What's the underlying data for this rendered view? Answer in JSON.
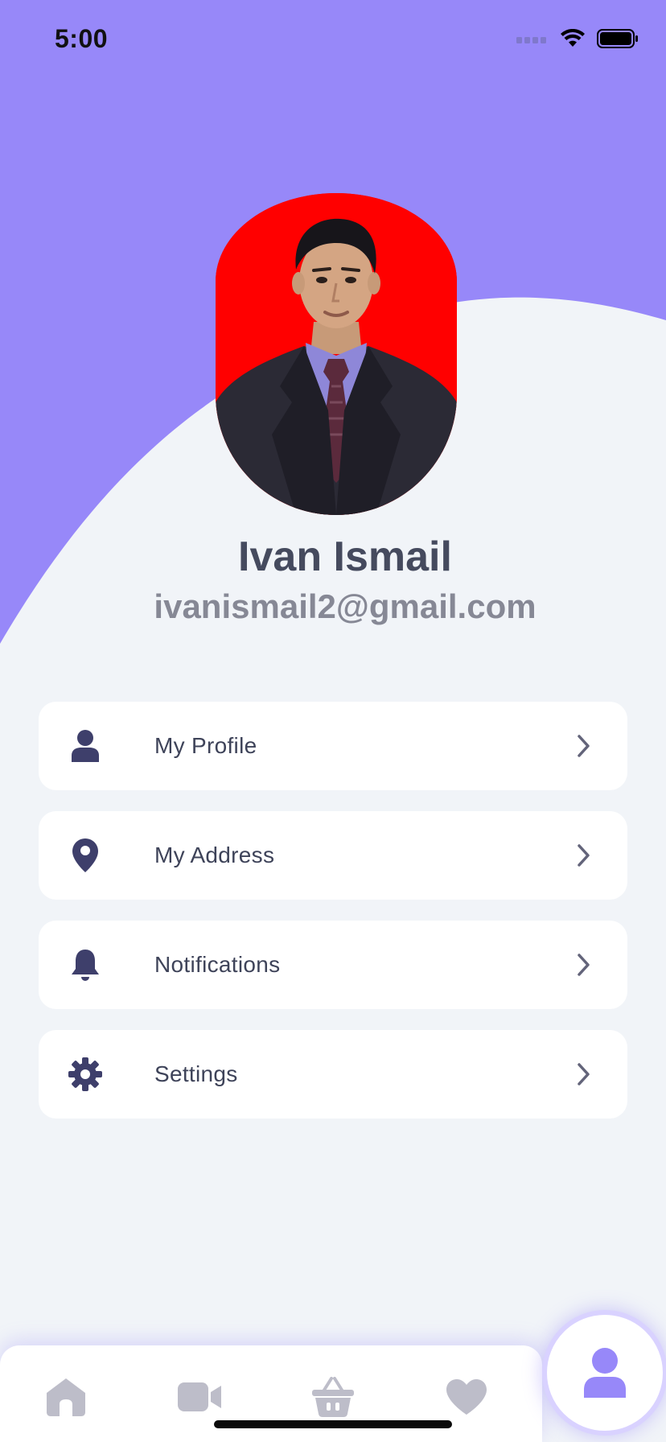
{
  "status_bar": {
    "time": "5:00"
  },
  "profile": {
    "name": "Ivan Ismail",
    "email": "ivanismail2@gmail.com",
    "avatar_icon": "profile-photo"
  },
  "menu": [
    {
      "label": "My Profile",
      "icon": "user-icon"
    },
    {
      "label": "My Address",
      "icon": "location-pin-icon"
    },
    {
      "label": "Notifications",
      "icon": "bell-icon"
    },
    {
      "label": "Settings",
      "icon": "gear-icon"
    }
  ],
  "bottom_nav": {
    "items": [
      "home-icon",
      "video-icon",
      "basket-icon",
      "heart-icon",
      "profile-icon"
    ],
    "active": "profile-icon"
  },
  "colors": {
    "accent": "#9788F9",
    "background": "#F1F4F8",
    "text_primary": "#454A5E",
    "text_secondary": "#868895",
    "icon_dark": "#3E3F6B",
    "nav_inactive": "#BDBDC9"
  }
}
